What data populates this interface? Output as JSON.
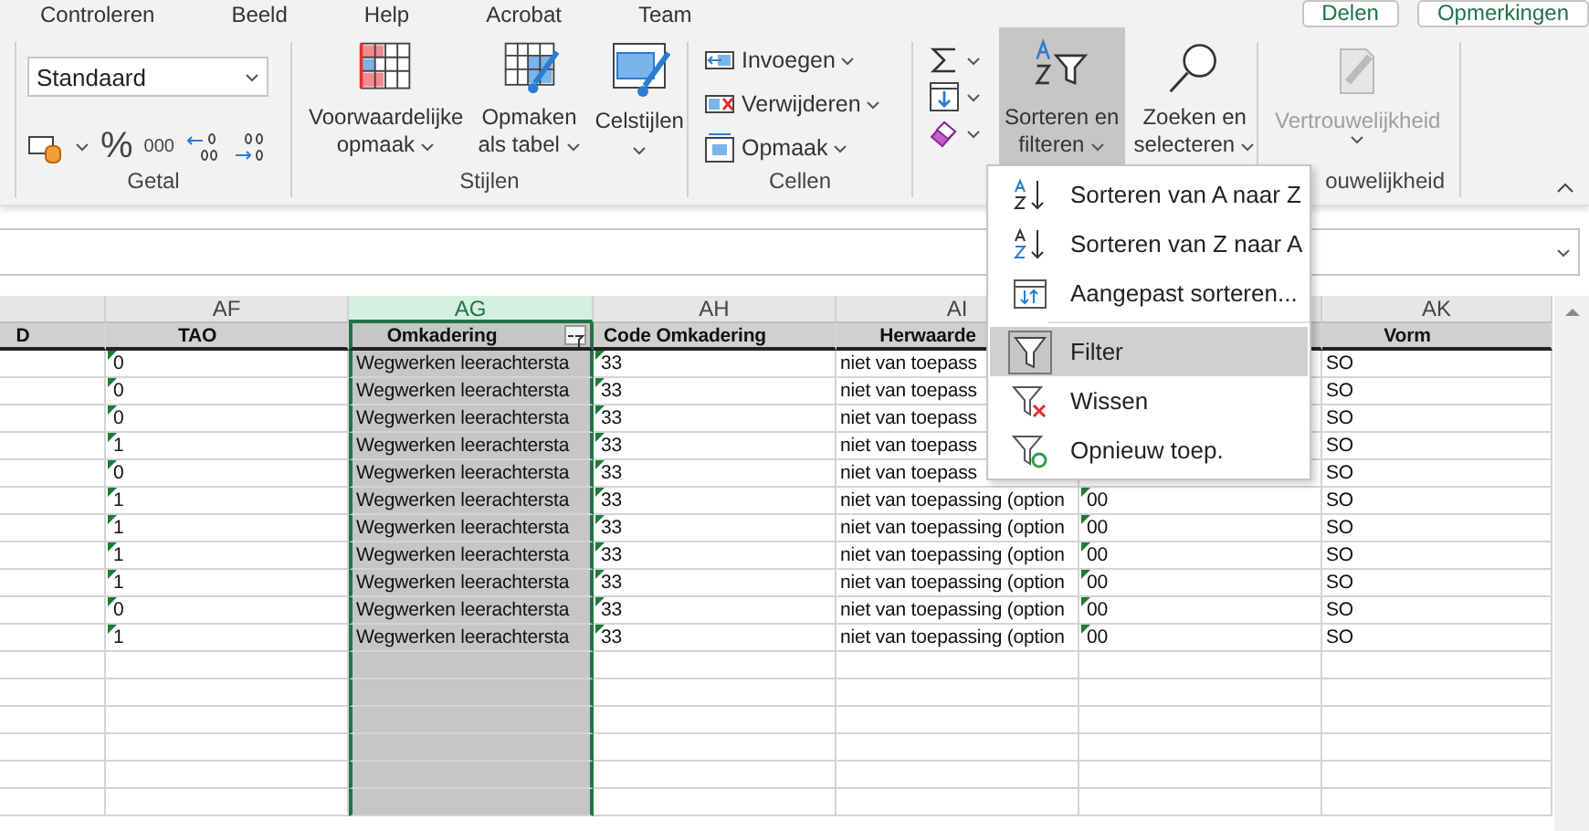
{
  "menu_tabs": [
    "Controleren",
    "Beeld",
    "Help",
    "Acrobat",
    "Team"
  ],
  "share_buttons": [
    "Delen",
    "Opmerkingen"
  ],
  "ribbon": {
    "number": {
      "format": "Standaard",
      "small_labels": [
        "%",
        "000"
      ],
      "label": "Getal"
    },
    "styles": {
      "label": "Stijlen",
      "buttons": [
        {
          "lines": [
            "Voorwaardelijke",
            "opmaak"
          ],
          "kind": "conditional"
        },
        {
          "lines": [
            "Opmaken",
            "als tabel"
          ],
          "kind": "table"
        },
        {
          "lines": [
            "Celstijlen"
          ],
          "kind": "cellstyles"
        }
      ]
    },
    "cells": {
      "label": "Cellen",
      "items": [
        {
          "label": "Invoegen",
          "kind": "insert"
        },
        {
          "label": "Verwijderen",
          "kind": "delete"
        },
        {
          "label": "Opmaak",
          "kind": "format"
        }
      ]
    },
    "editing": {
      "small": [
        {
          "kind": "sum"
        },
        {
          "kind": "fill"
        },
        {
          "kind": "clear"
        }
      ],
      "buttons": [
        {
          "lines": [
            "Sorteren en",
            "filteren"
          ],
          "kind": "sort",
          "selected": true
        },
        {
          "lines": [
            "Zoeken en",
            "selecteren"
          ],
          "kind": "find",
          "selected": false
        }
      ]
    },
    "sensitivity": {
      "lines": [
        "Vertrouwelijkheid"
      ],
      "disabled": true,
      "label": "ouwelijkheid"
    }
  },
  "sheet": {
    "columns": [
      {
        "header": "D",
        "selected": false
      },
      {
        "letter": "AF",
        "header": "TAO",
        "selected": false
      },
      {
        "letter": "AG",
        "header": "Omkadering",
        "selected": true,
        "filter": true
      },
      {
        "letter": "AH",
        "header": "Code Omkadering",
        "selected": false
      },
      {
        "letter": "AI",
        "header": "Herwaarde",
        "selected": false
      },
      {
        "selected": false
      },
      {
        "letter": "AK",
        "header": "Vorm",
        "selected": false
      }
    ],
    "rows": [
      [
        null,
        {
          "text": "0",
          "warning": true
        },
        {
          "text": "Wegwerken leerachtersta"
        },
        {
          "text": "33",
          "warning": true
        },
        {
          "text": "niet van toepass"
        },
        null,
        {
          "text": "SO"
        }
      ],
      [
        null,
        {
          "text": "0",
          "warning": true
        },
        {
          "text": "Wegwerken leerachtersta"
        },
        {
          "text": "33",
          "warning": true
        },
        {
          "text": "niet van toepass"
        },
        null,
        {
          "text": "SO"
        }
      ],
      [
        null,
        {
          "text": "0",
          "warning": true
        },
        {
          "text": "Wegwerken leerachtersta"
        },
        {
          "text": "33",
          "warning": true
        },
        {
          "text": "niet van toepass"
        },
        null,
        {
          "text": "SO"
        }
      ],
      [
        null,
        {
          "text": "1",
          "warning": true
        },
        {
          "text": "Wegwerken leerachtersta"
        },
        {
          "text": "33",
          "warning": true
        },
        {
          "text": "niet van toepass"
        },
        null,
        {
          "text": "SO"
        }
      ],
      [
        null,
        {
          "text": "0",
          "warning": true
        },
        {
          "text": "Wegwerken leerachtersta"
        },
        {
          "text": "33",
          "warning": true
        },
        {
          "text": "niet van toepass"
        },
        null,
        {
          "text": "SO"
        }
      ],
      [
        null,
        {
          "text": "1",
          "warning": true
        },
        {
          "text": "Wegwerken leerachtersta"
        },
        {
          "text": "33",
          "warning": true
        },
        {
          "text": "niet van toepassing (option"
        },
        {
          "text": "00",
          "warning": true
        },
        {
          "text": "SO"
        }
      ],
      [
        null,
        {
          "text": "1",
          "warning": true
        },
        {
          "text": "Wegwerken leerachtersta"
        },
        {
          "text": "33",
          "warning": true
        },
        {
          "text": "niet van toepassing (option"
        },
        {
          "text": "00",
          "warning": true
        },
        {
          "text": "SO"
        }
      ],
      [
        null,
        {
          "text": "1",
          "warning": true
        },
        {
          "text": "Wegwerken leerachtersta"
        },
        {
          "text": "33",
          "warning": true
        },
        {
          "text": "niet van toepassing (option"
        },
        {
          "text": "00",
          "warning": true
        },
        {
          "text": "SO"
        }
      ],
      [
        null,
        {
          "text": "1",
          "warning": true
        },
        {
          "text": "Wegwerken leerachtersta"
        },
        {
          "text": "33",
          "warning": true
        },
        {
          "text": "niet van toepassing (option"
        },
        {
          "text": "00",
          "warning": true
        },
        {
          "text": "SO"
        }
      ],
      [
        null,
        {
          "text": "0",
          "warning": true
        },
        {
          "text": "Wegwerken leerachtersta"
        },
        {
          "text": "33",
          "warning": true
        },
        {
          "text": "niet van toepassing (option"
        },
        {
          "text": "00",
          "warning": true
        },
        {
          "text": "SO"
        }
      ],
      [
        null,
        {
          "text": "1",
          "warning": true
        },
        {
          "text": "Wegwerken leerachtersta"
        },
        {
          "text": "33",
          "warning": true
        },
        {
          "text": "niet van toepassing (option"
        },
        {
          "text": "00",
          "warning": true
        },
        {
          "text": "SO"
        }
      ]
    ]
  },
  "sort_menu": [
    {
      "label": "Sorteren van A naar Z",
      "kind": "sort_asc",
      "selected": false
    },
    {
      "label": "Sorteren van Z naar A",
      "kind": "sort_desc",
      "selected": false
    },
    {
      "label": "Aangepast sorteren...",
      "kind": "custom_sort",
      "selected": false
    },
    {
      "label": "Filter",
      "kind": "filter",
      "selected": true,
      "separator_before": true
    },
    {
      "label": "Wissen",
      "kind": "clear",
      "selected": false
    },
    {
      "label": "Opnieuw toep.",
      "kind": "reapply",
      "selected": false
    }
  ]
}
